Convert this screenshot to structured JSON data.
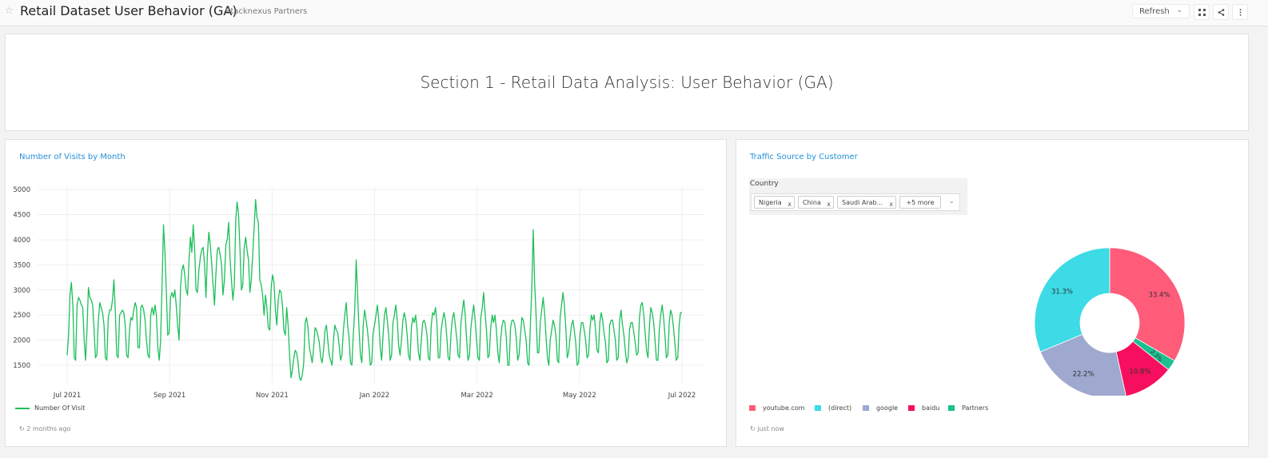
{
  "header": {
    "title": "Retail Dataset User Behavior (GA)",
    "owner": "Stacknexus Partners",
    "refresh_label": "Refresh",
    "icons": [
      "star-icon",
      "chevron-down-icon",
      "fullscreen-icon",
      "share-icon",
      "more-icon"
    ]
  },
  "section": {
    "title": "Section 1 - Retail Data Analysis: User Behavior (GA)"
  },
  "visits_panel": {
    "title": "Number of Visits by Month",
    "updated": "2 months ago"
  },
  "traffic_panel": {
    "title": "Traffic Source by Customer",
    "updated": "just now",
    "filter": {
      "label": "Country",
      "tags": [
        "Nigeria",
        "China",
        "Saudi Arab..."
      ],
      "more": "+5 more"
    }
  },
  "chart_data": [
    {
      "type": "line",
      "title": "Number of Visits by Month",
      "x_ticks": [
        "Jul 2021",
        "Sep 2021",
        "Nov 2021",
        "Jan 2022",
        "Mar 2022",
        "May 2022",
        "Jul 2022"
      ],
      "y_ticks": [
        1500,
        2000,
        2500,
        3000,
        3500,
        4000,
        4500,
        5000
      ],
      "ylim": [
        1150,
        5050
      ],
      "grid": true,
      "legend_position": "bottom-left",
      "series": [
        {
          "name": "Number Of Visit",
          "color": "#1dbf5a",
          "x_range": [
            "2021-07-01",
            "2022-07-01"
          ],
          "values": [
            1700,
            2100,
            2900,
            3150,
            2700,
            1650,
            1600,
            2700,
            2850,
            2800,
            2700,
            2650,
            2000,
            1600,
            2200,
            3050,
            2850,
            2800,
            2700,
            2200,
            1650,
            1700,
            2400,
            2750,
            2650,
            2550,
            2300,
            1650,
            1600,
            2450,
            2600,
            2600,
            2800,
            3200,
            2600,
            1700,
            1650,
            2500,
            2550,
            2600,
            2550,
            2300,
            1700,
            1650,
            2200,
            2450,
            2400,
            2600,
            2750,
            2650,
            1850,
            1850,
            2650,
            2700,
            2600,
            2400,
            2000,
            1700,
            1650,
            2500,
            2650,
            2500,
            2700,
            2500,
            1850,
            1600,
            2000,
            3100,
            4300,
            3750,
            3000,
            2100,
            2150,
            2850,
            2950,
            2850,
            3000,
            2700,
            2300,
            2000,
            3050,
            3400,
            3500,
            3300,
            3000,
            2900,
            3600,
            4050,
            3750,
            4300,
            3800,
            3000,
            2950,
            3400,
            3650,
            3800,
            3850,
            3500,
            2850,
            3700,
            4150,
            3900,
            3550,
            3100,
            2700,
            3300,
            3800,
            3850,
            3700,
            3500,
            2900,
            3200,
            3900,
            4000,
            4350,
            3600,
            3200,
            2800,
            3100,
            4400,
            4750,
            4500,
            3800,
            3000,
            3100,
            3850,
            4050,
            3800,
            3600,
            2950,
            3200,
            3700,
            4250,
            4800,
            4450,
            4350,
            3200,
            3100,
            2900,
            2500,
            2900,
            2650,
            2250,
            2200,
            3050,
            3300,
            3150,
            2600,
            2300,
            2800,
            3000,
            2950,
            2700,
            2200,
            2100,
            2650,
            2300,
            1700,
            1250,
            1400,
            1650,
            1800,
            1750,
            1550,
            1250,
            1200,
            1300,
            1550,
            2350,
            2450,
            2250,
            1850,
            1700,
            1550,
            1850,
            2250,
            2200,
            2100,
            1950,
            1650,
            1550,
            1800,
            2200,
            2300,
            2000,
            1700,
            1600,
            1500,
            2000,
            2300,
            2200,
            2150,
            1900,
            1600,
            1700,
            2200,
            2500,
            2750,
            2300,
            2050,
            1550,
            1500,
            2100,
            2600,
            3600,
            2950,
            2250,
            1700,
            1550,
            2300,
            2600,
            2400,
            2200,
            1900,
            1500,
            1550,
            2150,
            2300,
            2500,
            2700,
            2400,
            1850,
            1600,
            2100,
            2500,
            2650,
            2400,
            2100,
            1600,
            1700,
            2350,
            2500,
            2700,
            2400,
            1900,
            1700,
            2000,
            2400,
            2550,
            2400,
            2100,
            1700,
            1600,
            2250,
            2450,
            2350,
            2500,
            2200,
            1750,
            1600,
            2000,
            2350,
            2400,
            2300,
            2100,
            1650,
            1600,
            2300,
            2550,
            2500,
            2650,
            2350,
            1650,
            1650,
            2200,
            2400,
            2550,
            2400,
            2050,
            1650,
            1600,
            2150,
            2450,
            2550,
            2300,
            2050,
            1700,
            1650,
            2350,
            2600,
            2800,
            2500,
            2000,
            1600,
            1700,
            2250,
            2500,
            2700,
            2400,
            2000,
            1650,
            1600,
            2450,
            2650,
            2950,
            2550,
            2200,
            1650,
            1700,
            2250,
            2500,
            2350,
            2500,
            2200,
            1750,
            1550,
            2000,
            2300,
            2400,
            2350,
            2050,
            1500,
            1500,
            2250,
            2400,
            2400,
            2300,
            2050,
            1600,
            1700,
            2100,
            2450,
            2400,
            2200,
            2000,
            1550,
            1500,
            2300,
            3050,
            4200,
            3150,
            2500,
            1750,
            1750,
            2350,
            2600,
            2850,
            2550,
            2100,
            1650,
            1500,
            2000,
            2200,
            2400,
            2300,
            2100,
            1600,
            1550,
            2450,
            2700,
            2950,
            2700,
            2250,
            1650,
            1750,
            2050,
            2300,
            2400,
            2200,
            1950,
            1500,
            1550,
            2100,
            2350,
            2350,
            2200,
            2000,
            1650,
            1700,
            2200,
            2500,
            2400,
            2500,
            2200,
            1800,
            1750,
            2350,
            2550,
            2400,
            2150,
            1950,
            1550,
            1600,
            2300,
            2400,
            2400,
            2200,
            2000,
            1600,
            1650,
            2400,
            2600,
            2300,
            2100,
            1800,
            1550,
            1650,
            2200,
            2350,
            2350,
            2150,
            1950,
            1700,
            1750,
            2450,
            2700,
            2750,
            2500,
            2150,
            1800,
            1650,
            2250,
            2650,
            2550,
            2350,
            2000,
            1600,
            1600,
            2200,
            2500,
            2700,
            2450,
            2100,
            1650,
            1700,
            2350,
            2600,
            2500,
            2250,
            1950,
            1600,
            1650,
            2300,
            2550,
            2550
          ]
        }
      ]
    },
    {
      "type": "pie",
      "title": "Traffic Source by Customer",
      "donut": true,
      "legend_position": "bottom-left",
      "slices": [
        {
          "label": "youtube.com",
          "value": 33.4,
          "color": "#ff5c7a",
          "text": "33.4%"
        },
        {
          "label": "Partners",
          "value": 2.3,
          "color": "#1cbf8f",
          "text": "2.3%"
        },
        {
          "label": "baidu",
          "value": 10.8,
          "color": "#f50f5e",
          "text": "10.8%"
        },
        {
          "label": "google",
          "value": 22.2,
          "color": "#9fa8cf",
          "text": "22.2%"
        },
        {
          "label": "(direct)",
          "value": 31.3,
          "color": "#3cdbe6",
          "text": "31.3%"
        }
      ],
      "legend": [
        {
          "label": "youtube.com",
          "color": "#ff5c7a"
        },
        {
          "label": "(direct)",
          "color": "#3cdbe6"
        },
        {
          "label": "google",
          "color": "#9fa8cf"
        },
        {
          "label": "baidu",
          "color": "#f50f5e"
        },
        {
          "label": "Partners",
          "color": "#1cbf8f"
        }
      ]
    }
  ]
}
